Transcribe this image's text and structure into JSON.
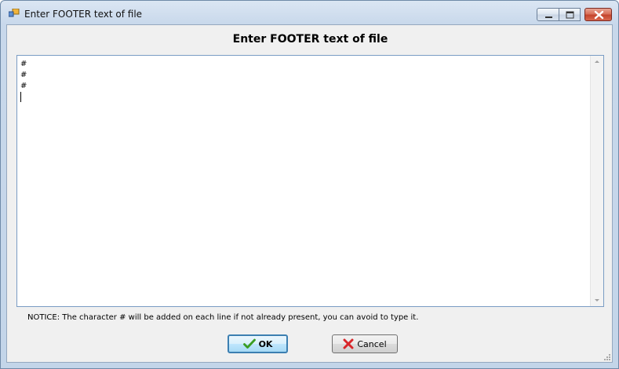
{
  "window": {
    "title": "Enter FOOTER text of file",
    "icon": "app-window-icon",
    "caption_buttons": [
      "minimize-icon",
      "maximize-icon",
      "close-icon"
    ]
  },
  "dialog": {
    "heading": "Enter FOOTER text of file",
    "text_lines": [
      "#",
      "#",
      "#"
    ],
    "notice": "NOTICE: The character # will be added on each line if not already present, you can avoid to type it.",
    "ok_label": "OK",
    "ok_icon": "checkmark-icon",
    "cancel_label": "Cancel",
    "cancel_icon": "x-cross-icon"
  },
  "colors": {
    "ok_accent": "#3c7fb1",
    "close_button": "#c4452d",
    "check_green": "#3a9d23",
    "cross_red": "#d8262a"
  }
}
